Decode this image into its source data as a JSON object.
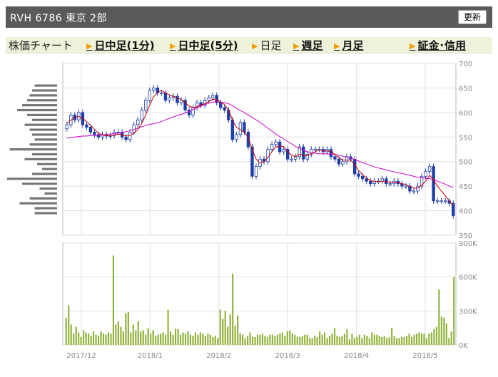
{
  "header": {
    "title": "RVH  6786  東京 2部",
    "refresh_label": "更新"
  },
  "nav": {
    "items": [
      {
        "label": "株価チャート",
        "link": false,
        "arrow": false
      },
      {
        "label": "日中足(1分)",
        "link": true,
        "arrow": true
      },
      {
        "label": "日中足(5分)",
        "link": true,
        "arrow": true
      },
      {
        "label": "日足",
        "link": false,
        "arrow": true
      },
      {
        "label": "週足",
        "link": true,
        "arrow": true
      },
      {
        "label": "月足",
        "link": true,
        "arrow": true
      },
      {
        "label": "証金･信用",
        "link": true,
        "arrow": true
      }
    ]
  },
  "colors": {
    "up": "#ffffff",
    "down": "#1f3ea8",
    "ma_short": "#cc0000",
    "ma_long": "#cc00cc",
    "volume": "#8fb33a",
    "profile": "#777777"
  },
  "chart_data": [
    {
      "type": "candlestick",
      "ylim": [
        350,
        700
      ],
      "yticks": [
        "350",
        "400",
        "450",
        "500",
        "550",
        "600",
        "650",
        "700"
      ],
      "x_tick_labels": [
        "2017/12",
        "2018/1",
        "2018/2",
        "2018/3",
        "2018/4",
        "2018/5"
      ],
      "close": [
        575,
        595,
        585,
        600,
        575,
        570,
        560,
        555,
        550,
        555,
        552,
        553,
        560,
        560,
        550,
        545,
        560,
        575,
        585,
        605,
        625,
        645,
        650,
        640,
        640,
        625,
        630,
        633,
        620,
        625,
        605,
        595,
        610,
        620,
        615,
        625,
        630,
        635,
        620,
        610,
        605,
        585,
        545,
        555,
        580,
        560,
        530,
        470,
        490,
        505,
        500,
        525,
        535,
        540,
        520,
        525,
        505,
        505,
        510,
        530,
        505,
        515,
        525,
        525,
        525,
        520,
        525,
        510,
        505,
        495,
        500,
        510,
        505,
        475,
        470,
        465,
        460,
        455,
        460,
        460,
        465,
        455,
        455,
        460,
        455,
        450,
        450,
        440,
        440,
        450,
        470,
        480,
        490,
        420,
        420,
        420,
        420,
        415,
        390
      ],
      "ma_short": [
        578,
        584,
        590,
        592,
        588,
        581,
        574,
        566,
        558,
        554,
        553,
        552,
        554,
        556,
        555,
        552,
        553,
        558,
        565,
        578,
        595,
        615,
        632,
        641,
        645,
        640,
        636,
        633,
        630,
        627,
        620,
        613,
        610,
        612,
        615,
        618,
        622,
        627,
        626,
        622,
        616,
        605,
        585,
        570,
        565,
        560,
        550,
        525,
        505,
        497,
        500,
        508,
        520,
        530,
        532,
        530,
        520,
        513,
        510,
        515,
        512,
        512,
        516,
        520,
        524,
        522,
        522,
        520,
        515,
        508,
        503,
        503,
        503,
        494,
        482,
        473,
        467,
        461,
        460,
        459,
        460,
        459,
        458,
        458,
        457,
        455,
        453,
        449,
        446,
        446,
        452,
        460,
        472,
        463,
        450,
        440,
        430,
        420,
        410
      ],
      "ma_long": [
        548,
        549,
        550,
        551,
        552,
        552,
        553,
        553,
        553,
        554,
        555,
        556,
        557,
        558,
        559,
        561,
        563,
        565,
        568,
        571,
        574,
        576,
        577,
        579,
        582,
        585,
        588,
        591,
        594,
        596,
        599,
        602,
        606,
        610,
        613,
        616,
        619,
        621,
        622,
        621,
        620,
        618,
        614,
        609,
        604,
        600,
        595,
        590,
        585,
        580,
        574,
        568,
        562,
        556,
        551,
        546,
        541,
        536,
        531,
        527,
        523,
        520,
        518,
        517,
        516,
        516,
        516,
        515,
        514,
        513,
        511,
        509,
        507,
        504,
        501,
        498,
        495,
        492,
        489,
        487,
        485,
        483,
        481,
        479,
        477,
        476,
        474,
        472,
        470,
        468,
        467,
        466,
        465,
        463,
        460,
        457,
        454,
        450,
        447
      ],
      "price_profile": [
        {
          "price": 655,
          "vol": 0.45
        },
        {
          "price": 645,
          "vol": 0.5
        },
        {
          "price": 635,
          "vol": 0.55
        },
        {
          "price": 625,
          "vol": 0.6
        },
        {
          "price": 615,
          "vol": 0.7
        },
        {
          "price": 605,
          "vol": 0.8
        },
        {
          "price": 595,
          "vol": 0.6
        },
        {
          "price": 585,
          "vol": 0.5
        },
        {
          "price": 575,
          "vol": 0.65
        },
        {
          "price": 565,
          "vol": 0.55
        },
        {
          "price": 555,
          "vol": 0.5
        },
        {
          "price": 545,
          "vol": 0.45
        },
        {
          "price": 535,
          "vol": 0.55
        },
        {
          "price": 525,
          "vol": 0.95
        },
        {
          "price": 515,
          "vol": 0.5
        },
        {
          "price": 505,
          "vol": 0.65
        },
        {
          "price": 495,
          "vol": 0.4
        },
        {
          "price": 485,
          "vol": 0.3
        },
        {
          "price": 475,
          "vol": 0.5
        },
        {
          "price": 465,
          "vol": 1.0
        },
        {
          "price": 455,
          "vol": 0.7
        },
        {
          "price": 445,
          "vol": 0.35
        },
        {
          "price": 435,
          "vol": 0.25
        },
        {
          "price": 425,
          "vol": 0.55
        },
        {
          "price": 415,
          "vol": 0.75
        },
        {
          "price": 405,
          "vol": 0.45
        },
        {
          "price": 395,
          "vol": 0.45
        }
      ]
    },
    {
      "type": "bar",
      "ylim": [
        0,
        900000
      ],
      "yticks": [
        "0K",
        "300K",
        "600K",
        "900K"
      ],
      "values": [
        240000,
        350000,
        180000,
        100000,
        160000,
        110000,
        70000,
        130000,
        110000,
        100000,
        80000,
        120000,
        90000,
        80000,
        120000,
        100000,
        90000,
        110000,
        100000,
        790000,
        180000,
        210000,
        160000,
        120000,
        280000,
        290000,
        110000,
        180000,
        130000,
        210000,
        120000,
        130000,
        90000,
        150000,
        100000,
        130000,
        80000,
        90000,
        100000,
        110000,
        90000,
        310000,
        120000,
        90000,
        140000,
        140000,
        90000,
        110000,
        100000,
        120000,
        90000,
        80000,
        110000,
        90000,
        110000,
        100000,
        80000,
        100000,
        90000,
        70000,
        80000,
        60000,
        310000,
        230000,
        300000,
        160000,
        270000,
        630000,
        170000,
        260000,
        100000,
        90000,
        60000,
        80000,
        110000,
        70000,
        70000,
        90000,
        90000,
        100000,
        80000,
        70000,
        90000,
        90000,
        80000,
        90000,
        100000,
        110000,
        80000,
        120000,
        130000,
        100000,
        90000,
        70000,
        70000,
        80000,
        90000,
        90000,
        60000,
        60000,
        80000,
        70000,
        120000,
        90000,
        110000,
        60000,
        80000,
        100000,
        150000,
        80000,
        70000,
        80000,
        100000,
        140000,
        50000,
        100000,
        60000,
        70000,
        90000,
        60000,
        90000,
        80000,
        60000,
        110000,
        90000,
        90000,
        80000,
        70000,
        80000,
        60000,
        70000,
        150000,
        80000,
        60000,
        60000,
        70000,
        70000,
        80000,
        100000,
        70000,
        90000,
        100000,
        110000,
        100000,
        100000,
        60000,
        100000,
        110000,
        140000,
        160000,
        490000,
        250000,
        240000,
        190000,
        60000,
        120000,
        600000
      ]
    }
  ]
}
